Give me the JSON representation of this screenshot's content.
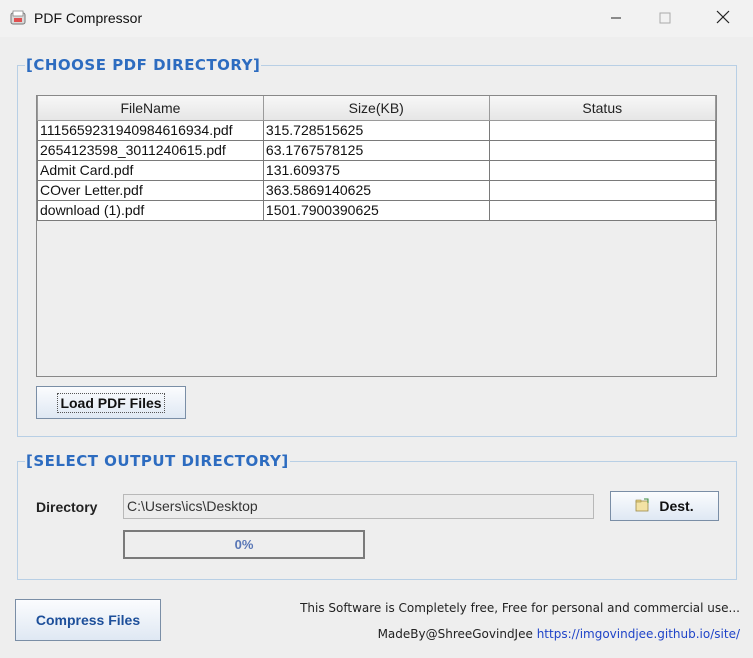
{
  "window": {
    "title": "PDF Compressor",
    "icons": {
      "app": "pdf-app-icon",
      "minimize": "minimize-icon",
      "maximize": "maximize-icon",
      "close": "close-icon"
    }
  },
  "choose_panel": {
    "title": "[CHOOSE PDF DIRECTORY]",
    "columns": [
      "FileName",
      "Size(KB)",
      "Status"
    ],
    "rows": [
      {
        "name": "1115659231940984616934.pdf",
        "size": "315.728515625",
        "status": ""
      },
      {
        "name": "2654123598_3011240615.pdf",
        "size": "63.1767578125",
        "status": ""
      },
      {
        "name": "Admit Card.pdf",
        "size": "131.609375",
        "status": ""
      },
      {
        "name": "COver Letter.pdf",
        "size": "363.5869140625",
        "status": ""
      },
      {
        "name": "download (1).pdf",
        "size": "1501.7900390625",
        "status": ""
      }
    ],
    "load_button": "Load PDF Files"
  },
  "output_panel": {
    "title": "[SELECT OUTPUT DIRECTORY]",
    "directory_label": "Directory",
    "directory_value": "C:\\Users\\ics\\Desktop",
    "dest_button": "Dest.",
    "dest_icon": "folder-icon",
    "progress_value": 0,
    "progress_text": "0%"
  },
  "footer": {
    "compress_button": "Compress Files",
    "note": "This Software is Completely free, Free for personal and commercial use...",
    "credit_prefix": "MadeBy@ShreeGovindJee ",
    "credit_link": "https://imgovindjee.github.io/site/"
  },
  "colors": {
    "accent": "#2d6cc0",
    "panel_border": "#b8cfe5",
    "progress": "#5876b6",
    "link": "#1f44c8"
  }
}
